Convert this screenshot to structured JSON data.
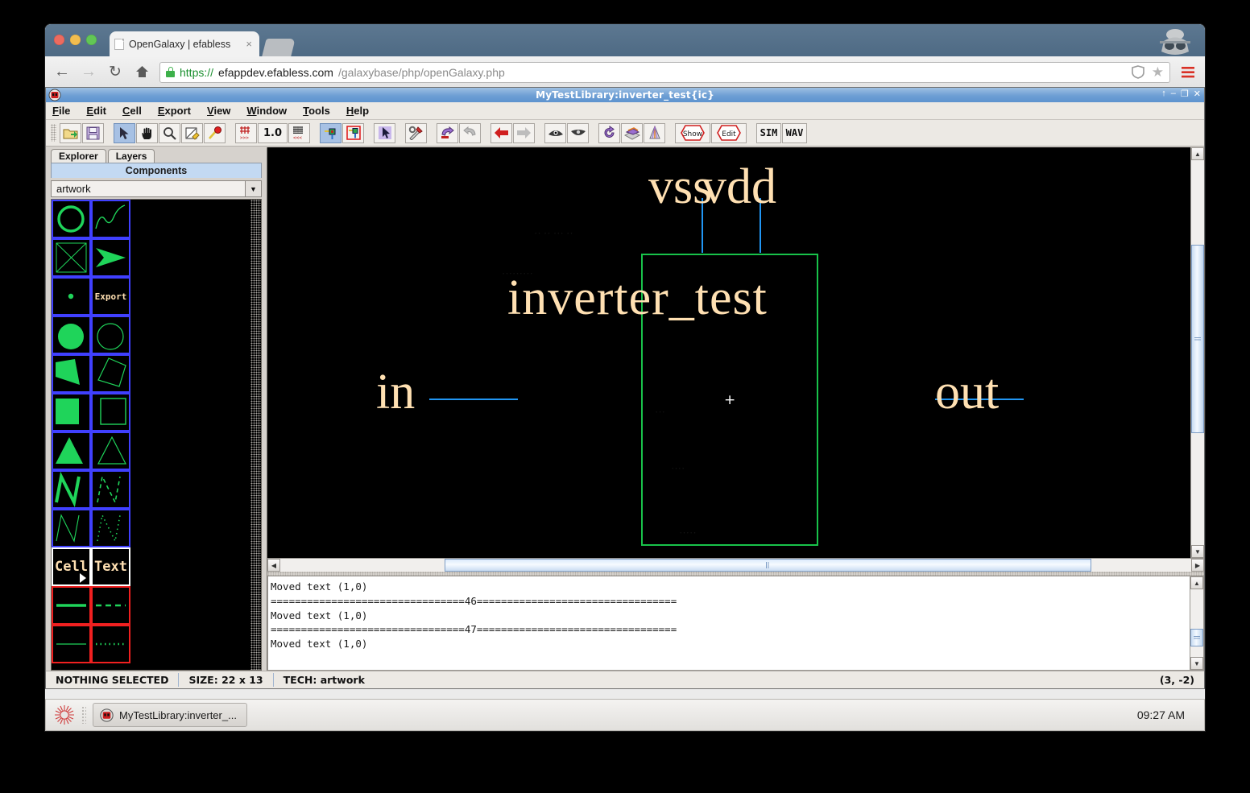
{
  "browser": {
    "tab": {
      "title": "OpenGalaxy | efabless",
      "close": "×"
    },
    "url": {
      "scheme": "https://",
      "host": "efappdev.efabless.com",
      "path": "/galaxybase/php/openGalaxy.php"
    },
    "nav": {
      "back": "←",
      "forward": "→",
      "reload": "↻",
      "home": "⌂",
      "shield": "shield-icon",
      "star": "★",
      "menu": "☰"
    }
  },
  "app": {
    "title": "MyTestLibrary:inverter_test{ic}",
    "window_buttons": {
      "restore": "↑",
      "minimize": "–",
      "maximize": "❐",
      "close": "✕"
    },
    "menu": [
      "File",
      "Edit",
      "Cell",
      "Export",
      "View",
      "Window",
      "Tools",
      "Help"
    ],
    "toolbar": {
      "groups": [
        {
          "buttons": [
            {
              "name": "open-library-button",
              "icon": "folder-open-icon",
              "label": ""
            },
            {
              "name": "save-library-button",
              "icon": "floppy-disk-icon",
              "label": ""
            }
          ]
        },
        {
          "buttons": [
            {
              "name": "select-tool-button",
              "icon": "arrow-cursor-icon",
              "label": "",
              "active": true
            },
            {
              "name": "pan-tool-button",
              "icon": "hand-icon",
              "label": ""
            },
            {
              "name": "zoom-tool-button",
              "icon": "magnifier-icon",
              "label": ""
            },
            {
              "name": "outline-tool-button",
              "icon": "outline-pencil-icon",
              "label": ""
            },
            {
              "name": "wire-tool-button",
              "icon": "wire-pin-icon",
              "label": ""
            }
          ]
        },
        {
          "buttons": [
            {
              "name": "grid-toggle-button",
              "icon": "grid-icon",
              "label": ""
            },
            {
              "name": "grid-size-button",
              "icon": "",
              "label": "1.0"
            },
            {
              "name": "fine-grid-button",
              "icon": "fine-grid-icon",
              "label": ""
            }
          ]
        },
        {
          "buttons": [
            {
              "name": "expand-cell-button",
              "icon": "expand-node-icon",
              "label": "",
              "active": true
            },
            {
              "name": "unexpand-cell-button",
              "icon": "unexpand-node-icon",
              "label": ""
            }
          ]
        },
        {
          "buttons": [
            {
              "name": "select-objects-button",
              "icon": "pointer-highlight-icon",
              "label": ""
            }
          ]
        },
        {
          "buttons": [
            {
              "name": "tools-button",
              "icon": "screwdriver-wrench-icon",
              "label": ""
            }
          ]
        },
        {
          "buttons": [
            {
              "name": "undo-button",
              "icon": "undo-arrow-icon",
              "label": ""
            },
            {
              "name": "redo-button",
              "icon": "redo-arrow-icon",
              "label": "",
              "disabled": true
            }
          ]
        },
        {
          "buttons": [
            {
              "name": "go-back-button",
              "icon": "left-arrow-icon",
              "label": ""
            },
            {
              "name": "go-forward-button",
              "icon": "right-arrow-icon",
              "label": "",
              "disabled": true
            }
          ]
        },
        {
          "buttons": [
            {
              "name": "peek-up-button",
              "icon": "eye-up-icon",
              "label": ""
            },
            {
              "name": "peek-down-button",
              "icon": "eye-down-icon",
              "label": ""
            }
          ]
        },
        {
          "buttons": [
            {
              "name": "rotate-button",
              "icon": "rotate-icon",
              "label": ""
            },
            {
              "name": "layout-view-button",
              "icon": "layer-stack-icon",
              "label": ""
            },
            {
              "name": "3d-view-button",
              "icon": "prism-icon",
              "label": ""
            }
          ]
        },
        {
          "buttons": [
            {
              "name": "show-network-button",
              "icon": "hexagon-icon",
              "label": "Show"
            },
            {
              "name": "edit-network-button",
              "icon": "hexagon-icon",
              "label": "Edit"
            }
          ]
        },
        {
          "buttons": [
            {
              "name": "simulate-button",
              "icon": "",
              "label": "SIM"
            },
            {
              "name": "waveform-button",
              "icon": "",
              "label": "WAV"
            }
          ]
        }
      ]
    },
    "sidebar": {
      "tabs": [
        {
          "label": "Explorer",
          "active": true
        },
        {
          "label": "Layers",
          "active": false
        }
      ],
      "section_title": "Components",
      "technology_select": {
        "value": "artwork",
        "arrow": "▼"
      },
      "palette": [
        [
          {
            "name": "circle-outline-swatch",
            "kind": "circle-outline",
            "border": "blue"
          },
          {
            "name": "spline-swatch",
            "kind": "spline",
            "border": "blue"
          }
        ],
        [
          {
            "name": "box-crossed-swatch",
            "kind": "crossbox",
            "border": "blue"
          },
          {
            "name": "arrow-filled-swatch",
            "kind": "arrowhead",
            "border": "blue"
          }
        ],
        [
          {
            "name": "dot-swatch",
            "kind": "dot",
            "border": "blue"
          },
          {
            "name": "export-text-swatch",
            "kind": "text",
            "text": "Export",
            "border": "blue"
          }
        ],
        [
          {
            "name": "disc-filled-swatch",
            "kind": "disc-filled",
            "border": "blue"
          },
          {
            "name": "disc-outline-swatch",
            "kind": "disc-outline",
            "border": "blue"
          }
        ],
        [
          {
            "name": "polygon-filled-swatch",
            "kind": "poly-filled",
            "border": "blue"
          },
          {
            "name": "polygon-outline-swatch",
            "kind": "poly-outline",
            "border": "blue"
          }
        ],
        [
          {
            "name": "rect-filled-swatch",
            "kind": "rect-filled",
            "border": "blue"
          },
          {
            "name": "rect-outline-swatch",
            "kind": "rect-outline",
            "border": "blue"
          }
        ],
        [
          {
            "name": "triangle-filled-swatch",
            "kind": "tri-filled",
            "border": "blue"
          },
          {
            "name": "triangle-outline-swatch",
            "kind": "tri-outline",
            "border": "blue"
          }
        ],
        [
          {
            "name": "zigzag-thick-swatch",
            "kind": "zig-thick",
            "border": "blue"
          },
          {
            "name": "zigzag-dashed-swatch",
            "kind": "zig-dashed",
            "border": "blue"
          }
        ],
        [
          {
            "name": "zigzag-thin-swatch",
            "kind": "zig-thin",
            "border": "blue"
          },
          {
            "name": "zigzag-dotted-swatch",
            "kind": "zig-dotted",
            "border": "blue"
          }
        ],
        [
          {
            "name": "cell-swatch",
            "kind": "text",
            "text": "Cell",
            "border": "white",
            "cursor": true
          },
          {
            "name": "text-swatch",
            "kind": "text",
            "text": "Text",
            "border": "white"
          }
        ],
        [
          {
            "name": "line-solid-thick-swatch",
            "kind": "line-solid-thick",
            "border": "red"
          },
          {
            "name": "line-dashed-swatch",
            "kind": "line-dashed",
            "border": "red"
          }
        ],
        [
          {
            "name": "line-solid-thin-swatch",
            "kind": "line-solid-thin",
            "border": "red"
          },
          {
            "name": "line-dotted-swatch",
            "kind": "line-dotted",
            "border": "red"
          }
        ]
      ]
    },
    "canvas": {
      "cell_label": "inverter_test",
      "port_labels": [
        {
          "name": "vss",
          "text": "vss"
        },
        {
          "name": "vdd",
          "text": "vdd"
        },
        {
          "name": "in",
          "text": "in"
        },
        {
          "name": "out",
          "text": "out"
        }
      ],
      "crosshair": "+",
      "box_color": "#18c24a",
      "wire_color": "#2196f3",
      "text_color": "#ffe0b2"
    },
    "console": {
      "lines": [
        "Moved text (1,0)",
        "================================46=================================",
        "Moved text (1,0)",
        "================================47=================================",
        "Moved text (1,0)"
      ]
    },
    "status": {
      "selection": "NOTHING SELECTED",
      "size": "SIZE: 22 x 13",
      "tech": "TECH: artwork",
      "coords": "(3, -2)"
    }
  },
  "taskbar": {
    "item": "MyTestLibrary:inverter_...",
    "clock": "09:27 AM"
  }
}
